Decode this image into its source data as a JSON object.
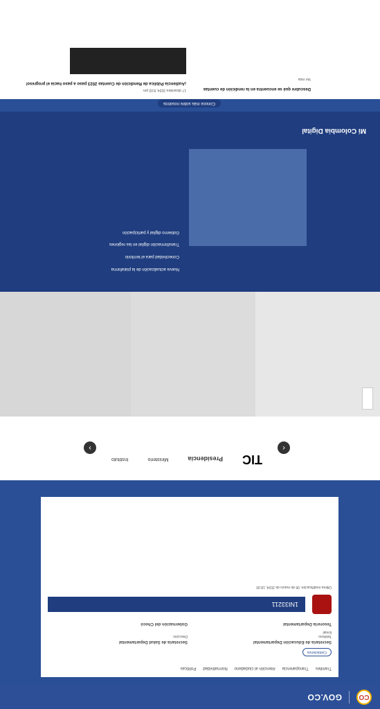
{
  "header": {
    "logo_label": "CO",
    "brand": "GOV.CO"
  },
  "topcard": {
    "links": [
      "Tramites",
      "Transparencia",
      "Atención al ciudadano",
      "Normatividad",
      "Políticas"
    ],
    "contact_button": "Contáctenos",
    "notes": [
      "Última modificación: 06 de marzo de 2024, 18:30",
      "Secretaría de Educación Departamental",
      "Secretaría de Salud Departamental",
      "Tesorería Departamental",
      "Gobernación del Chocó"
    ],
    "phone_label": "Teléfono",
    "email_label": "Email",
    "address_label": "Dirección",
    "badge_code": "1NI33211"
  },
  "partners": {
    "logos": [
      "TIC",
      "Presidencia",
      "Ministerio",
      "Instituto"
    ]
  },
  "media_section": {
    "title": "Mi Colombia Digital",
    "button": "Conoce más sobre nosotros",
    "items": [
      "Nueva actualización de la plataforma",
      "Conectividad para el territorio",
      "Transformación digital en las regiones",
      "Gobierno digital y participación"
    ]
  },
  "news": {
    "title": "¡Audiencia Pública de Rendición de Cuentas 2023 paso a paso hacia el progreso!",
    "date": "17 diciembre 2024, 8:02 pm",
    "second_title": "Descubre qué se encuentra en la rendición de cuentas",
    "read_more": "Ver más"
  }
}
